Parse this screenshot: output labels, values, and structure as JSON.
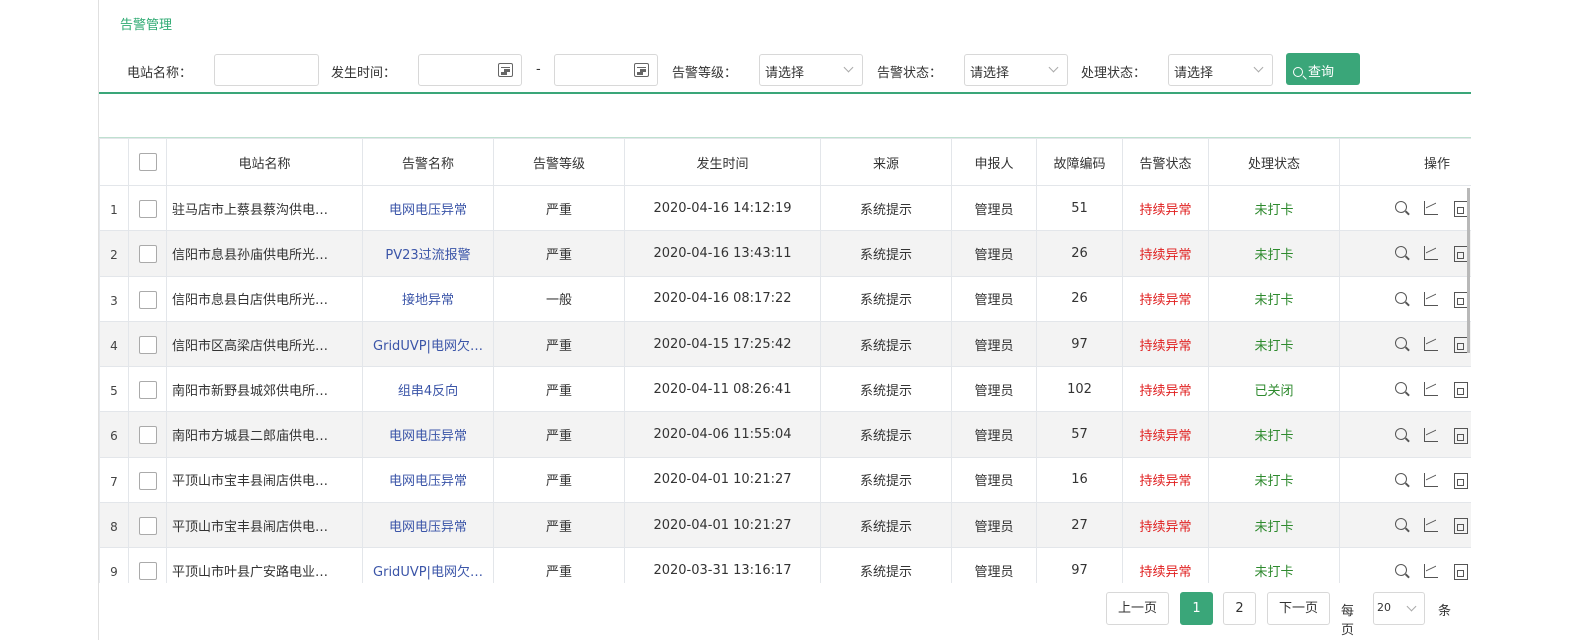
{
  "breadcrumb": "告警管理",
  "filters": {
    "station_label": "电站名称：",
    "station_value": "",
    "time_label": "发生时间：",
    "time_from": "",
    "time_sep": "-",
    "time_to": "",
    "level_label": "告警等级：",
    "level_value": "请选择",
    "alarm_status_label": "告警状态：",
    "alarm_status_value": "请选择",
    "process_label": "处理状态：",
    "process_value": "请选择",
    "query_label": "查询"
  },
  "table": {
    "columns": [
      "电站名称",
      "告警名称",
      "告警等级",
      "发生时间",
      "来源",
      "申报人",
      "故障编码",
      "告警状态",
      "处理状态",
      "操作"
    ],
    "rows": [
      {
        "n": "1",
        "station": "驻马店市上蔡县蔡沟供电…",
        "alarm": "电网电压异常",
        "level": "严重",
        "time": "2020-04-16 14:12:19",
        "source": "系统提示",
        "reporter": "管理员",
        "code": "51",
        "astatus": "持续异常",
        "pstatus": "未打卡"
      },
      {
        "n": "2",
        "station": "信阳市息县孙庙供电所光…",
        "alarm": "PV23过流报警",
        "level": "严重",
        "time": "2020-04-16 13:43:11",
        "source": "系统提示",
        "reporter": "管理员",
        "code": "26",
        "astatus": "持续异常",
        "pstatus": "未打卡"
      },
      {
        "n": "3",
        "station": "信阳市息县白店供电所光…",
        "alarm": "接地异常",
        "level": "一般",
        "time": "2020-04-16 08:17:22",
        "source": "系统提示",
        "reporter": "管理员",
        "code": "26",
        "astatus": "持续异常",
        "pstatus": "未打卡"
      },
      {
        "n": "4",
        "station": "信阳市区高梁店供电所光…",
        "alarm": "GridUVP|电网欠…",
        "level": "严重",
        "time": "2020-04-15 17:25:42",
        "source": "系统提示",
        "reporter": "管理员",
        "code": "97",
        "astatus": "持续异常",
        "pstatus": "未打卡"
      },
      {
        "n": "5",
        "station": "南阳市新野县城郊供电所…",
        "alarm": "组串4反向",
        "level": "严重",
        "time": "2020-04-11 08:26:41",
        "source": "系统提示",
        "reporter": "管理员",
        "code": "102",
        "astatus": "持续异常",
        "pstatus": "已关闭"
      },
      {
        "n": "6",
        "station": "南阳市方城县二郎庙供电…",
        "alarm": "电网电压异常",
        "level": "严重",
        "time": "2020-04-06 11:55:04",
        "source": "系统提示",
        "reporter": "管理员",
        "code": "57",
        "astatus": "持续异常",
        "pstatus": "未打卡"
      },
      {
        "n": "7",
        "station": "平顶山市宝丰县闹店供电…",
        "alarm": "电网电压异常",
        "level": "严重",
        "time": "2020-04-01 10:21:27",
        "source": "系统提示",
        "reporter": "管理员",
        "code": "16",
        "astatus": "持续异常",
        "pstatus": "未打卡"
      },
      {
        "n": "8",
        "station": "平顶山市宝丰县闹店供电…",
        "alarm": "电网电压异常",
        "level": "严重",
        "time": "2020-04-01 10:21:27",
        "source": "系统提示",
        "reporter": "管理员",
        "code": "27",
        "astatus": "持续异常",
        "pstatus": "未打卡"
      },
      {
        "n": "9",
        "station": "平顶山市叶县广安路电业…",
        "alarm": "GridUVP|电网欠…",
        "level": "严重",
        "time": "2020-03-31 13:16:17",
        "source": "系统提示",
        "reporter": "管理员",
        "code": "97",
        "astatus": "持续异常",
        "pstatus": "未打卡"
      }
    ]
  },
  "pager": {
    "prev": "上一页",
    "pages": [
      "1",
      "2"
    ],
    "current": "1",
    "next": "下一页",
    "per_page_label": "每页",
    "per_page_value": "20",
    "unit": "条"
  },
  "colors": {
    "accent": "#3aa679",
    "alarm_link": "#3b55a8",
    "alarm_status": "#e02020",
    "process_status": "#2e8a2e"
  }
}
